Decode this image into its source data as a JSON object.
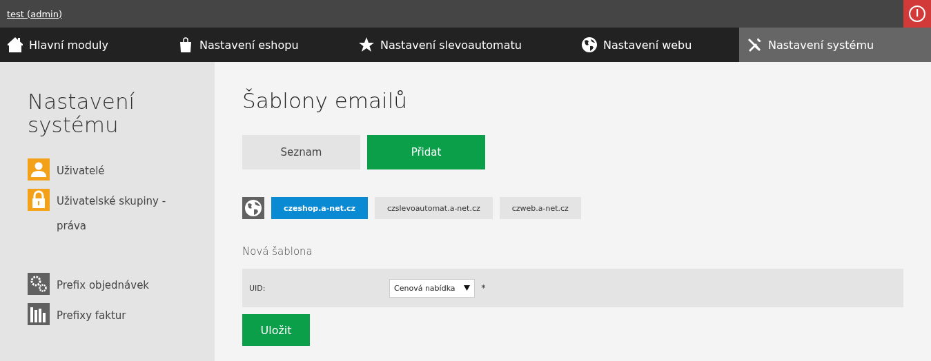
{
  "top_bar": {
    "user": "test (admin)"
  },
  "nav": [
    {
      "label": "Hlavní moduly",
      "selected": false
    },
    {
      "label": "Nastavení eshopu",
      "selected": false
    },
    {
      "label": "Nastavení slevoautomatu",
      "selected": false
    },
    {
      "label": "Nastavení webu",
      "selected": false
    },
    {
      "label": "Nastavení systému",
      "selected": true
    }
  ],
  "sidebar": {
    "title": "Nastavení systému",
    "groups": [
      {
        "items": [
          {
            "label": "Uživatelé",
            "color": "#f4a11a"
          },
          {
            "label": "Uživatelské skupiny - práva",
            "color": "#f4a11a"
          }
        ]
      },
      {
        "items": [
          {
            "label": "Prefix objednávek",
            "color": "#616161"
          },
          {
            "label": "Prefixy faktur",
            "color": "#616161"
          }
        ]
      }
    ]
  },
  "main": {
    "title": "Šablony emailů",
    "actions": [
      {
        "label": "Seznam",
        "selected": false
      },
      {
        "label": "Přidat",
        "selected": true
      }
    ],
    "domains": [
      {
        "label": "czeshop.a-net.cz",
        "selected": true
      },
      {
        "label": "czslevoautomat.a-net.cz",
        "selected": false
      },
      {
        "label": "czweb.a-net.cz",
        "selected": false
      }
    ],
    "form": {
      "title": "Nová šablona",
      "fields": [
        {
          "label": "UID:",
          "value": "Cenová nabídka",
          "required": "*"
        }
      ],
      "submit": "Uložit"
    }
  }
}
